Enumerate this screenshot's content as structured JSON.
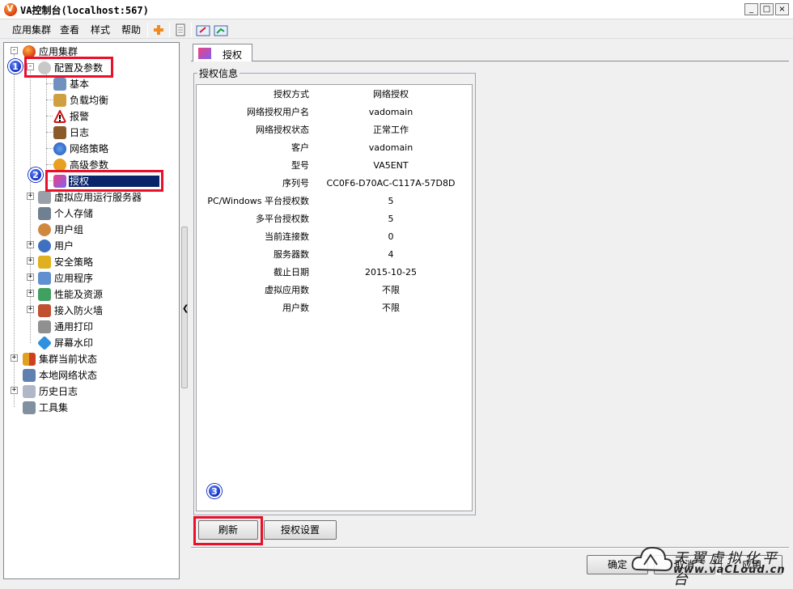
{
  "window": {
    "title": "VA控制台(localhost:567)",
    "min_glyph": "_",
    "max_glyph": "□",
    "close_glyph": "×"
  },
  "menu": {
    "items": [
      "应用集群",
      "查看",
      "样式",
      "帮助"
    ]
  },
  "toolbar": {
    "icons": [
      "add-icon",
      "document-icon",
      "export-icon",
      "import-icon"
    ]
  },
  "tree": {
    "root": "应用集群",
    "config_group": "配置及参数",
    "config_children": [
      "基本",
      "负载均衡",
      "报警",
      "日志",
      "网络策略",
      "高级参数",
      "授权"
    ],
    "selected": "授权",
    "cluster_children": [
      "虚拟应用运行服务器",
      "个人存储",
      "用户组",
      "用户",
      "安全策略",
      "应用程序",
      "性能及资源",
      "接入防火墙",
      "通用打印",
      "屏幕水印"
    ],
    "top_items": [
      "集群当前状态",
      "本地网络状态",
      "历史日志",
      "工具集"
    ]
  },
  "badges": [
    "1",
    "2",
    "3"
  ],
  "tab": {
    "label": "授权"
  },
  "auth_info": {
    "group_title": "授权信息",
    "rows": [
      {
        "label": "授权方式",
        "value": "网络授权"
      },
      {
        "label": "网络授权用户名",
        "value": "vadomain"
      },
      {
        "label": "网络授权状态",
        "value": "正常工作"
      },
      {
        "label": "客户",
        "value": "vadomain"
      },
      {
        "label": "型号",
        "value": "VA5ENT"
      },
      {
        "label": "序列号",
        "value": "CC0F6-D70AC-C117A-57D8D"
      },
      {
        "label": "PC/Windows 平台授权数",
        "value": "5"
      },
      {
        "label": "多平台授权数",
        "value": "5"
      },
      {
        "label": "当前连接数",
        "value": "0"
      },
      {
        "label": "服务器数",
        "value": "4"
      },
      {
        "label": "截止日期",
        "value": "2015-10-25"
      },
      {
        "label": "虚拟应用数",
        "value": "不限"
      },
      {
        "label": "用户数",
        "value": "不限"
      }
    ]
  },
  "buttons": {
    "refresh": "刷新",
    "auth_settings": "授权设置",
    "ok": "确定",
    "cancel": "取消",
    "apply": "应用"
  },
  "watermark": {
    "text": "天翼虚拟化平台",
    "url": "www.vaCLoud.cn"
  },
  "colors": {
    "highlight_box": "#e8102a",
    "selection": "#0a246a",
    "badge": "#1030c0"
  }
}
